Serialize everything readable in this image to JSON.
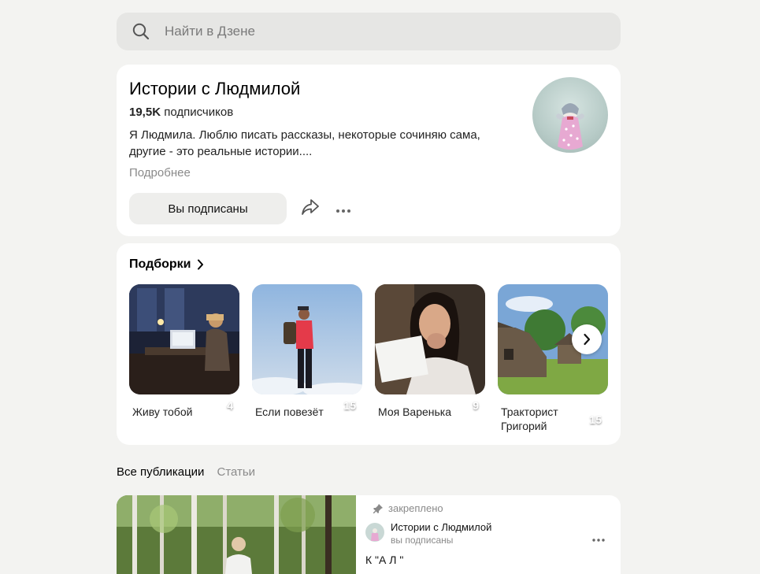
{
  "search": {
    "placeholder": "Найти в Дзене"
  },
  "channel": {
    "title": "Истории с Людмилой",
    "subscribers_count": "19,5K",
    "subscribers_label": "подписчиков",
    "description": "Я Людмила. Люблю писать рассказы, некоторые сочиняю сама, другие - это реальные истории....",
    "more_label": "Подробнее",
    "subscribed_label": "Вы подписаны"
  },
  "collections": {
    "title": "Подборки",
    "items": [
      {
        "label": "Живу тобой",
        "count": "4"
      },
      {
        "label": "Если повезёт",
        "count": "15"
      },
      {
        "label": "Моя Варенька",
        "count": "9"
      },
      {
        "label": "Тракторист Григорий",
        "count": "15"
      }
    ]
  },
  "tabs": [
    {
      "label": "Все публикации",
      "active": true
    },
    {
      "label": "Статьи",
      "active": false
    }
  ],
  "post": {
    "pinned_label": "закреплено",
    "author": "Истории с Людмилой",
    "status": "вы подписаны",
    "text": "К         \"А         Л         \""
  },
  "colors": {
    "background": "#f3f3f1",
    "card": "#ffffff",
    "muted": "#8a8a8a"
  }
}
